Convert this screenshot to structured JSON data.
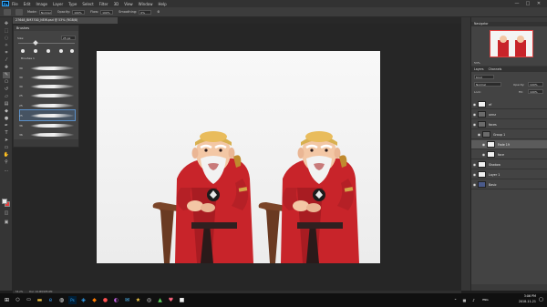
{
  "app": {
    "logo": "Ps"
  },
  "menu": [
    "File",
    "Edit",
    "Image",
    "Layer",
    "Type",
    "Select",
    "Filter",
    "3D",
    "View",
    "Window",
    "Help"
  ],
  "window_controls": [
    "—",
    "□",
    "✕"
  ],
  "options_bar": {
    "mode_label": "Mode:",
    "mode_value": "Normal",
    "opacity_label": "Opacity:",
    "opacity_value": "100%",
    "flow_label": "Flow:",
    "flow_value": "100%",
    "smoothing_label": "Smoothing:",
    "smoothing_value": "0%"
  },
  "document_tab": "27648_BM3700_NEW.psd @ 53% (RGB/8)",
  "brush_panel": {
    "title": "Brushes",
    "size_label": "Size:",
    "size_value": "25 px",
    "group_label": "Brushes 1",
    "preset_sizes": [
      "30",
      "30",
      "30",
      "25",
      "25",
      "25",
      "36",
      "36",
      "36"
    ]
  },
  "navigator": {
    "title": "Navigator",
    "zoom": "53%"
  },
  "layers": {
    "tabs": [
      "Layers",
      "Channels"
    ],
    "kind_label": "Kind",
    "blend_mode": "Normal",
    "opacity_label": "Opacity:",
    "opacity_value": "100%",
    "fill_label": "Fill:",
    "fill_value": "100%",
    "lock_label": "Lock:",
    "items": [
      {
        "name": "ef",
        "visible": true
      },
      {
        "name": "unnz",
        "visible": true
      },
      {
        "name": "faces",
        "visible": true
      },
      {
        "name": "Group 1",
        "visible": true
      },
      {
        "name": "Fade 19",
        "visible": true,
        "selected": true
      },
      {
        "name": "face",
        "visible": true
      },
      {
        "name": "Shadow",
        "visible": true
      },
      {
        "name": "Layer 1",
        "visible": true
      },
      {
        "name": "Basic",
        "visible": true
      }
    ]
  },
  "status": {
    "zoom": "53.2%",
    "doc": "Doc: 24.9M/185.0M"
  },
  "taskbar": {
    "time": "3:06 PM",
    "date": "2018-11-21",
    "lang": "ENG"
  },
  "colors": {
    "robe": "#c8242a",
    "skin": "#f3c7a5",
    "accent": "#31a8ff"
  }
}
